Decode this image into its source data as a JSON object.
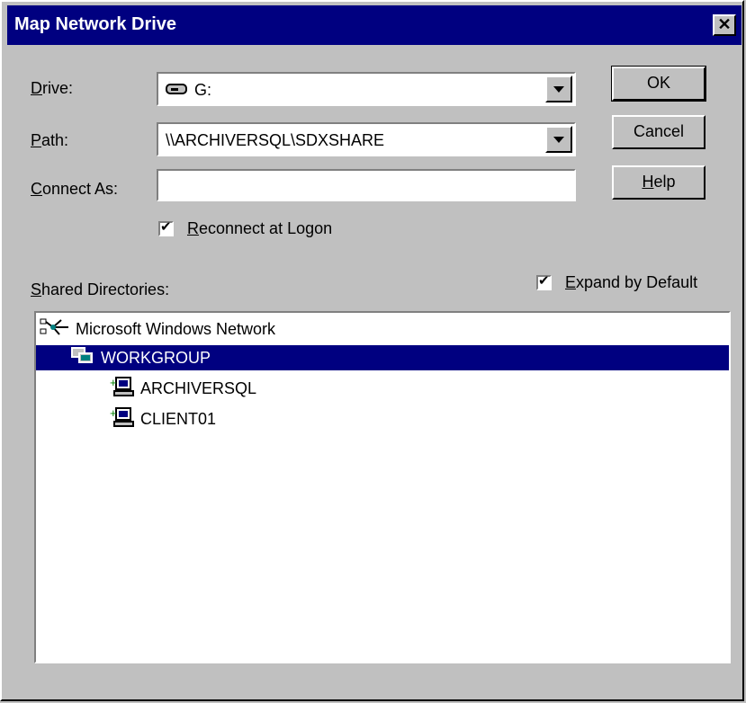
{
  "window": {
    "title": "Map Network Drive",
    "close_label": "✕"
  },
  "form": {
    "drive_label": "Drive:",
    "drive_value": "G:",
    "path_label": "Path:",
    "path_value": "\\\\ARCHIVERSQL\\SDXSHARE",
    "connect_as_label": "Connect As:",
    "connect_as_value": "",
    "reconnect_label": "Reconnect at Logon",
    "reconnect_checked": true
  },
  "buttons": {
    "ok": "OK",
    "cancel": "Cancel",
    "help": "Help"
  },
  "shared": {
    "label": "Shared Directories:",
    "expand_label": "Expand by Default",
    "expand_checked": true
  },
  "tree": {
    "root": "Microsoft Windows Network",
    "group": "WORKGROUP",
    "computers": [
      "ARCHIVERSQL",
      "CLIENT01"
    ]
  },
  "icons": {
    "root": "network-icon",
    "group": "workgroup-icon",
    "computer": "computer-icon",
    "drive": "drive-icon"
  },
  "colors": {
    "selection": "#000080",
    "titlebar": "#000080",
    "face": "#c0c0c0"
  }
}
